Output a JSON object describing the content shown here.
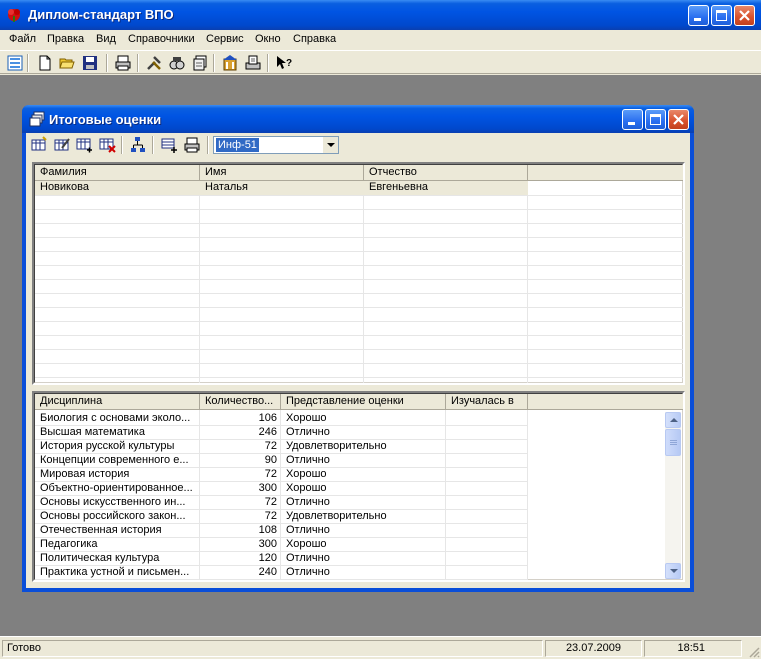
{
  "app": {
    "title": "Диплом-стандарт ВПО"
  },
  "menu": [
    {
      "label": "Файл"
    },
    {
      "label": "Правка"
    },
    {
      "label": "Вид"
    },
    {
      "label": "Справочники"
    },
    {
      "label": "Сервис"
    },
    {
      "label": "Окно"
    },
    {
      "label": "Справка"
    }
  ],
  "child": {
    "title": "Итоговые оценки",
    "group_combo_value": "Инф-51"
  },
  "students": {
    "columns": [
      "Фамилия",
      "Имя",
      "Отчество",
      ""
    ],
    "rows": [
      [
        "Новикова",
        "Наталья",
        "Евгеньевна"
      ]
    ]
  },
  "grades": {
    "columns": [
      "Дисциплина",
      "Количество...",
      "Представление оценки",
      "Изучалась в",
      ""
    ],
    "rows": [
      [
        "Биология с основами эколо...",
        "106",
        "Хорошо",
        ""
      ],
      [
        "Высшая математика",
        "246",
        "Отлично",
        ""
      ],
      [
        "История русской культуры",
        "72",
        "Удовлетворительно",
        ""
      ],
      [
        "Концепции современного е...",
        "90",
        "Отлично",
        ""
      ],
      [
        "Мировая история",
        "72",
        "Хорошо",
        ""
      ],
      [
        "Объектно-ориентированное...",
        "300",
        "Хорошо",
        ""
      ],
      [
        "Основы искусственного ин...",
        "72",
        "Отлично",
        ""
      ],
      [
        "Основы российского закон...",
        "72",
        "Удовлетворительно",
        ""
      ],
      [
        "Отечественная история",
        "108",
        "Отлично",
        ""
      ],
      [
        "Педагогика",
        "300",
        "Хорошо",
        ""
      ],
      [
        "Политическая культура",
        "120",
        "Отлично",
        ""
      ],
      [
        "Практика устной и письмен...",
        "240",
        "Отлично",
        ""
      ]
    ]
  },
  "status": {
    "text": "Готово",
    "date": "23.07.2009",
    "time": "18:51"
  },
  "colors": {
    "title_blue": "#0054e3",
    "selection_row": "#ece9d8",
    "mdi_background": "#808080"
  }
}
